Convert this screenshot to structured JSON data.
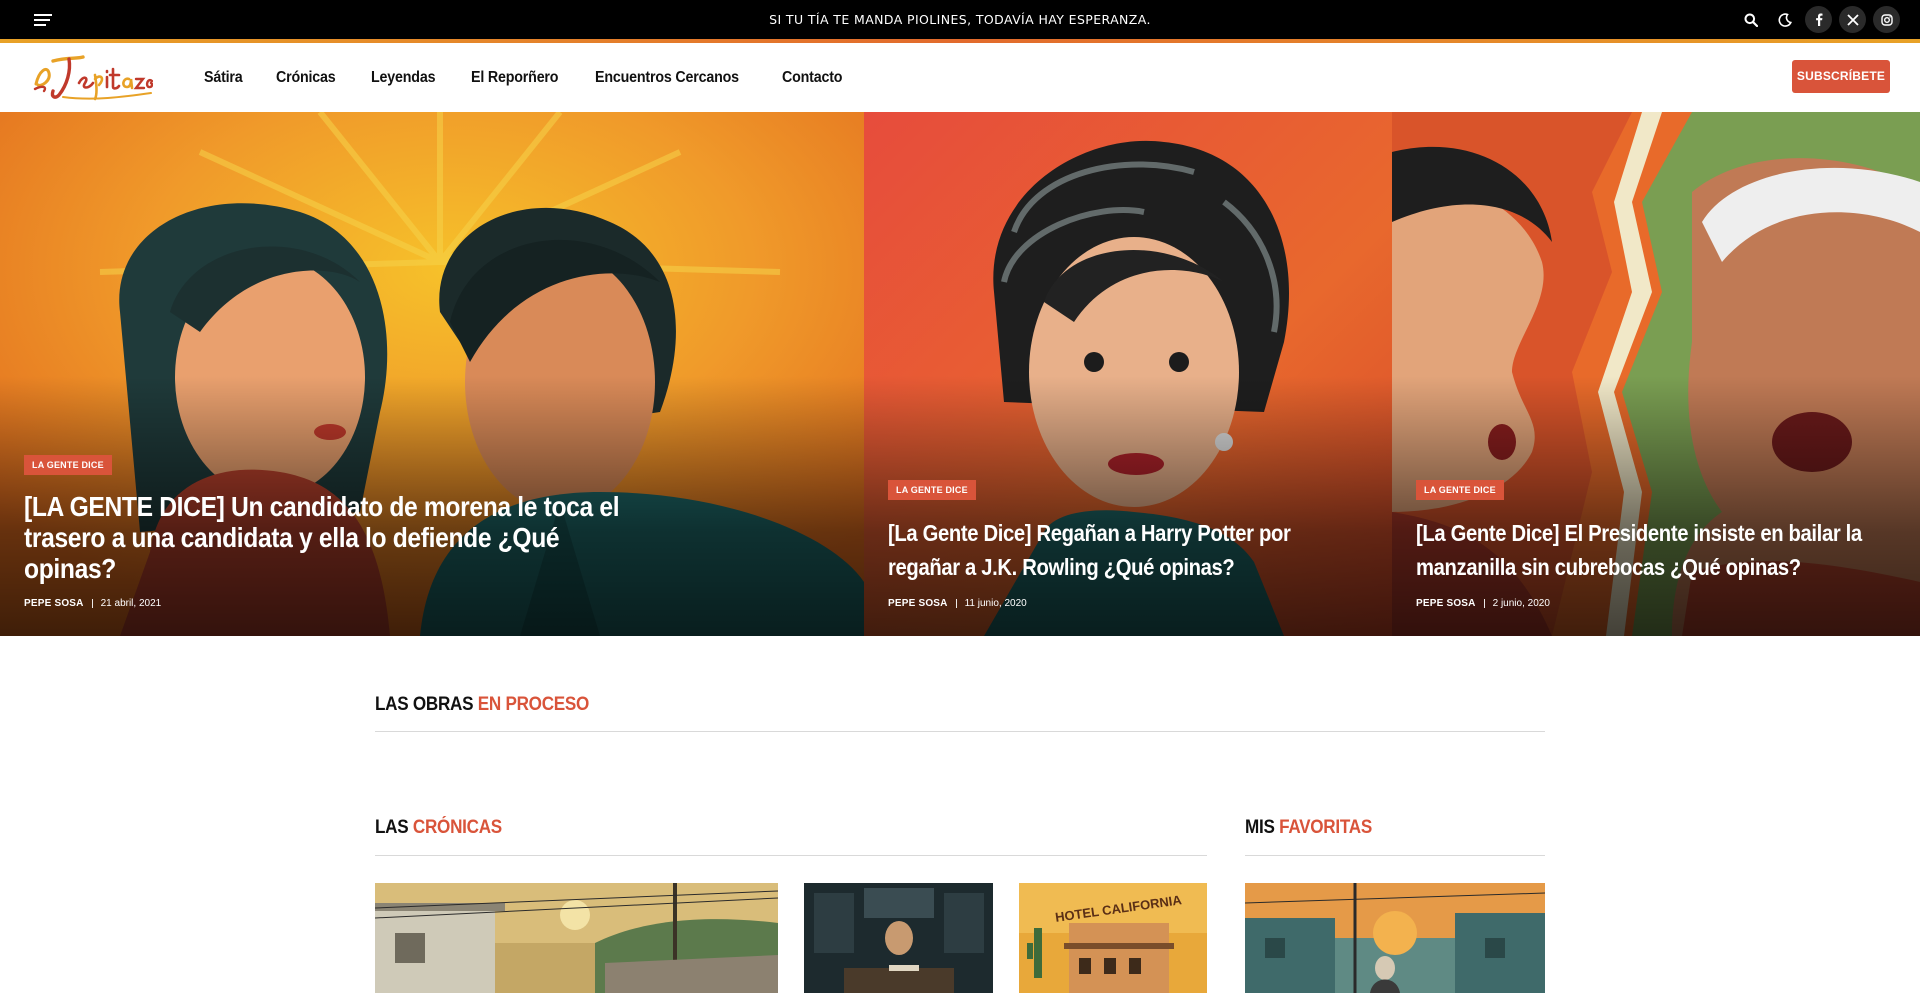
{
  "topbar": {
    "tagline": "SI TU TÍA TE MANDA PIOLINES, TODAVÍA HAY ESPERANZA.",
    "icons": [
      "menu-icon",
      "search-icon",
      "moon-icon",
      "facebook-icon",
      "x-icon",
      "instagram-icon"
    ]
  },
  "header": {
    "logo_text": "El Jepitazo",
    "nav": [
      "Sátira",
      "Crónicas",
      "Leyendas",
      "El Reporñero",
      "Encuentros Cercanos",
      "Contacto"
    ],
    "subscribe_label": "SUBSCRÍBETE"
  },
  "hero": [
    {
      "category": "LA GENTE DICE",
      "title": "[LA GENTE DICE] Un candidato de morena le toca el trasero a una candidata y ella lo defiende ¿Qué opinas?",
      "author": "PEPE SOSA",
      "date": "21 abril, 2021"
    },
    {
      "category": "LA GENTE DICE",
      "title": "[La Gente Dice] Regañan a Harry Potter por regañar a J.K. Rowling ¿Qué opinas?",
      "author": "PEPE SOSA",
      "date": "11 junio, 2020"
    },
    {
      "category": "LA GENTE DICE",
      "title": "[La Gente Dice] El Presidente insiste en bailar la manzanilla sin cubrebocas ¿Qué opinas?",
      "author": "PEPE SOSA",
      "date": "2 junio, 2020"
    }
  ],
  "sections": {
    "obras": {
      "lead": "LAS OBRAS",
      "accent": "EN PROCESO"
    },
    "cronicas": {
      "lead": "LAS",
      "accent": "CRÓNICAS"
    },
    "favoritas": {
      "lead": "MIS",
      "accent": "FAVORITAS"
    }
  },
  "thumb_text": {
    "hotel_sign": "HOTEL CALIFORNIA"
  },
  "colors": {
    "accent": "#d9543a",
    "topbar": "#000000",
    "stripe": "#e8a227"
  }
}
